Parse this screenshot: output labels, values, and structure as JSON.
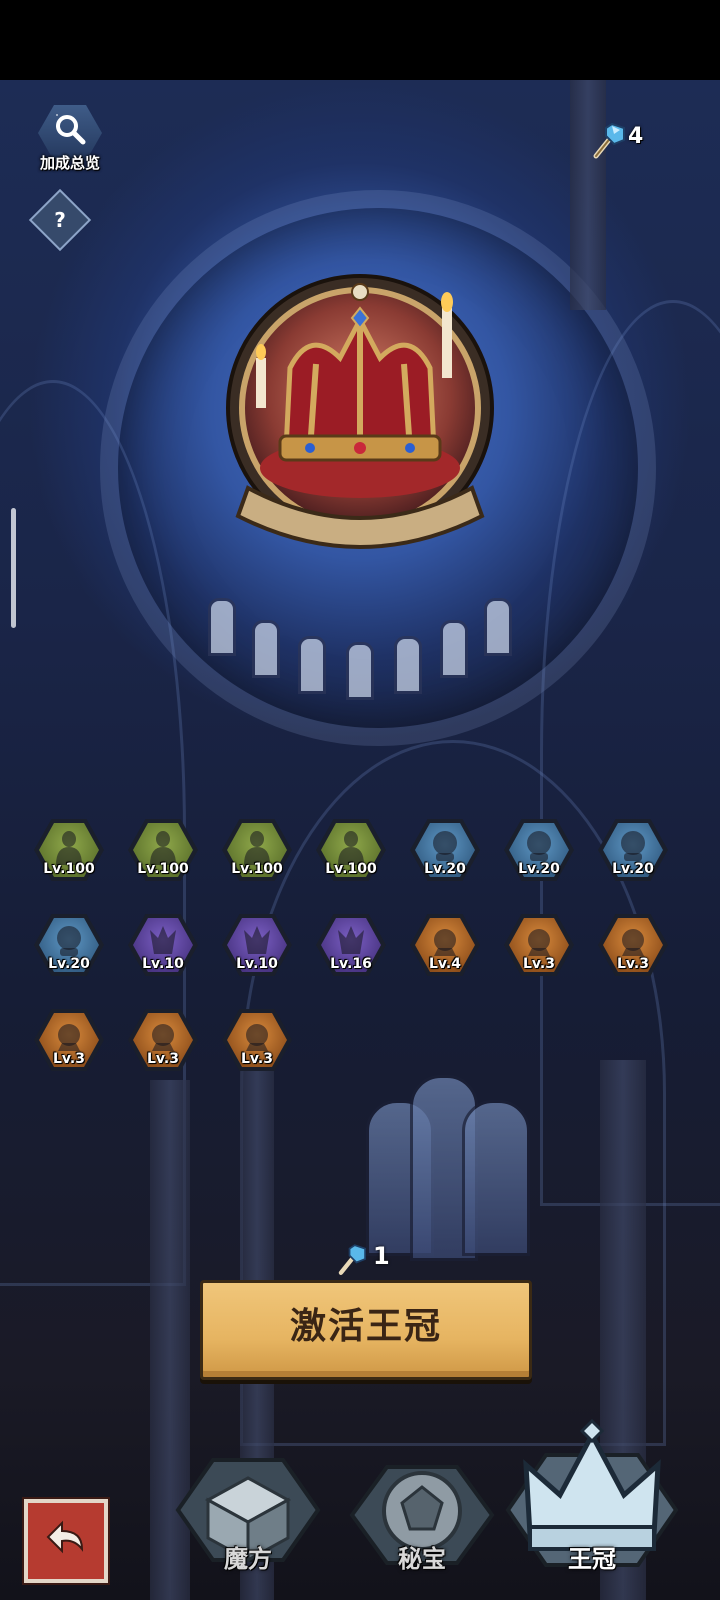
{
  "header": {
    "bonus_overview_label": "加成总览",
    "help_label": "?",
    "currency": {
      "icon": "wand-crystal-icon",
      "value": "4"
    }
  },
  "emblem": {
    "icon": "royal-crown-emblem"
  },
  "relics": [
    {
      "id": "hero-silhouette",
      "tier": "green",
      "level": "Lv.100",
      "icon": "person-silhouette-icon"
    },
    {
      "id": "bone",
      "tier": "green",
      "level": "Lv.100",
      "icon": "bone-icon"
    },
    {
      "id": "gentleman",
      "tier": "green",
      "level": "Lv.100",
      "icon": "top-hat-man-icon"
    },
    {
      "id": "chick",
      "tier": "green",
      "level": "Lv.100",
      "icon": "chick-icon"
    },
    {
      "id": "tiger",
      "tier": "blue",
      "level": "Lv.20",
      "icon": "tiger-icon"
    },
    {
      "id": "goblin",
      "tier": "blue",
      "level": "Lv.20",
      "icon": "goblin-head-icon"
    },
    {
      "id": "helmet",
      "tier": "blue",
      "level": "Lv.20",
      "icon": "knight-helmet-icon"
    },
    {
      "id": "balloon-creature",
      "tier": "blue",
      "level": "Lv.20",
      "icon": "balloon-creature-icon"
    },
    {
      "id": "demon-mask",
      "tier": "purple",
      "level": "Lv.10",
      "icon": "demon-mask-icon"
    },
    {
      "id": "magic-hat",
      "tier": "purple",
      "level": "Lv.10",
      "icon": "magic-hat-icon"
    },
    {
      "id": "rabbit",
      "tier": "purple",
      "level": "Lv.16",
      "icon": "rabbit-icon"
    },
    {
      "id": "octopus",
      "tier": "orange",
      "level": "Lv.4",
      "icon": "octopus-icon"
    },
    {
      "id": "flame-beast",
      "tier": "orange",
      "level": "Lv.3",
      "icon": "flame-beast-icon"
    },
    {
      "id": "blob-monster",
      "tier": "orange",
      "level": "Lv.3",
      "icon": "blob-monster-icon"
    },
    {
      "id": "bat",
      "tier": "orange",
      "level": "Lv.3",
      "icon": "bat-icon"
    },
    {
      "id": "king",
      "tier": "orange",
      "level": "Lv.3",
      "icon": "crowned-king-icon"
    },
    {
      "id": "pig",
      "tier": "orange",
      "level": "Lv.3",
      "icon": "pig-icon"
    }
  ],
  "activate": {
    "cost_icon": "wand-crystal-icon",
    "cost": "1",
    "label": "激活王冠"
  },
  "nav": {
    "back_icon": "back-arrow-icon",
    "tabs": [
      {
        "label": "魔方",
        "icon": "magic-cube-icon",
        "active": false
      },
      {
        "label": "秘宝",
        "icon": "gem-seal-icon",
        "active": false
      },
      {
        "label": "王冠",
        "icon": "crown-icon",
        "active": true
      }
    ]
  },
  "colors": {
    "tier_green": "#6e8a33",
    "tier_blue": "#3f78a6",
    "tier_purple": "#5a3f9e",
    "tier_orange": "#b8651f",
    "button_gold": "#e6b461"
  }
}
